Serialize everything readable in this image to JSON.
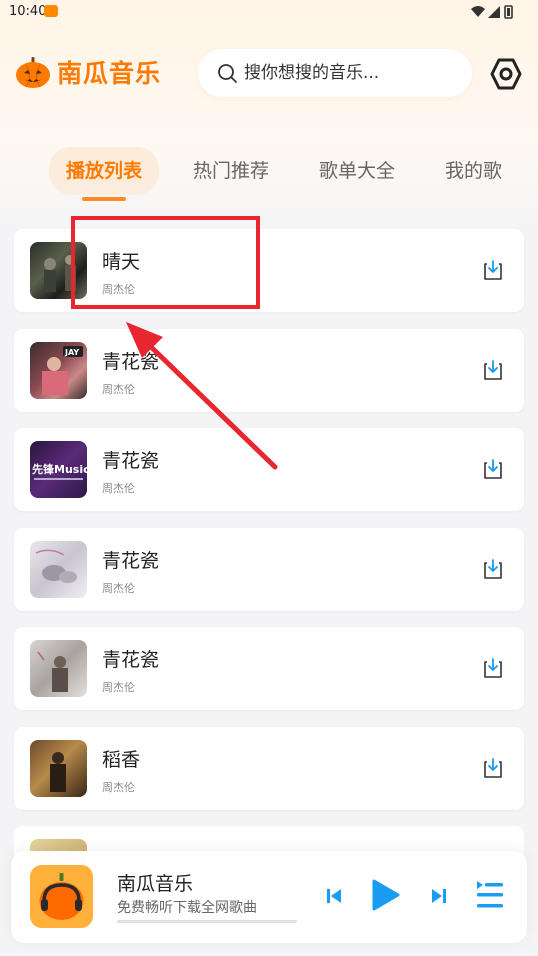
{
  "status_bar": {
    "time": "10:40"
  },
  "app": {
    "title": "南瓜音乐"
  },
  "search": {
    "placeholder": "搜你想搜的音乐..."
  },
  "tabs": [
    {
      "label": "播放列表",
      "active": true
    },
    {
      "label": "热门推荐",
      "active": false
    },
    {
      "label": "歌单大全",
      "active": false
    },
    {
      "label": "我的歌",
      "active": false
    }
  ],
  "songs": [
    {
      "title": "晴天",
      "artist": "周杰伦"
    },
    {
      "title": "青花瓷",
      "artist": "周杰伦"
    },
    {
      "title": "青花瓷",
      "artist": "周杰伦"
    },
    {
      "title": "青花瓷",
      "artist": "周杰伦"
    },
    {
      "title": "青花瓷",
      "artist": "周杰伦"
    },
    {
      "title": "稻香",
      "artist": "周杰伦"
    }
  ],
  "covers": {
    "cover2_badge": "JAY",
    "cover3_text": "先锋Music"
  },
  "player": {
    "title": "南瓜音乐",
    "subtitle": "免费畅听下载全网歌曲"
  },
  "icons": {
    "search": "search-icon",
    "settings": "gear-icon",
    "download": "download-icon",
    "prev": "skip-previous-icon",
    "play": "play-icon",
    "next": "skip-next-icon",
    "playlist": "playlist-icon"
  },
  "colors": {
    "accent": "#ff7a00",
    "player_controls": "#1a9cf0",
    "annotation": "#e8262f"
  }
}
